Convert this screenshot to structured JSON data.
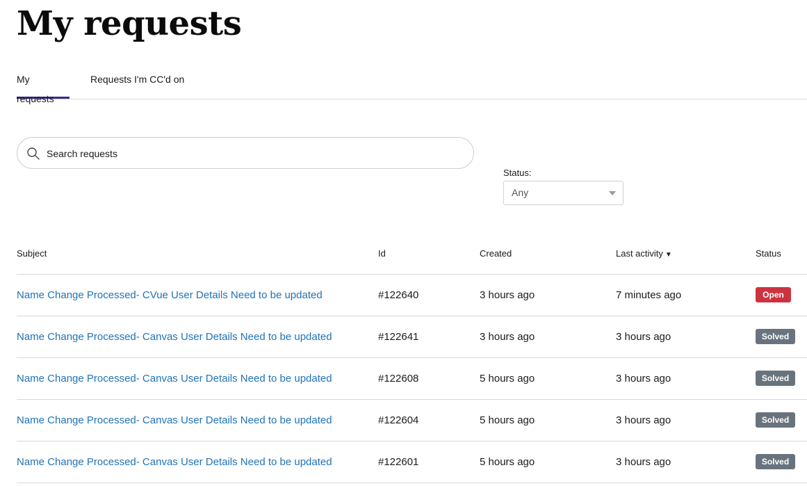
{
  "page": {
    "title": "My requests"
  },
  "tabs": [
    {
      "label": "My requests",
      "active": true
    },
    {
      "label": "Requests I'm CC'd on",
      "active": false
    }
  ],
  "search": {
    "placeholder": "Search requests",
    "value": "",
    "icon": "search-icon"
  },
  "filter": {
    "label": "Status:",
    "selected": "Any"
  },
  "table": {
    "headers": {
      "subject": "Subject",
      "id": "Id",
      "created": "Created",
      "last_activity": "Last activity",
      "status": "Status"
    },
    "sort_indicator": "▼",
    "rows": [
      {
        "subject": "Name Change Processed- CVue User Details Need to be updated",
        "id": "#122640",
        "created": "3 hours ago",
        "last_activity": "7 minutes ago",
        "status": "Open"
      },
      {
        "subject": "Name Change Processed- Canvas User Details Need to be updated",
        "id": "#122641",
        "created": "3 hours ago",
        "last_activity": "3 hours ago",
        "status": "Solved"
      },
      {
        "subject": "Name Change Processed- Canvas User Details Need to be updated",
        "id": "#122608",
        "created": "5 hours ago",
        "last_activity": "3 hours ago",
        "status": "Solved"
      },
      {
        "subject": "Name Change Processed- Canvas User Details Need to be updated",
        "id": "#122604",
        "created": "5 hours ago",
        "last_activity": "3 hours ago",
        "status": "Solved"
      },
      {
        "subject": "Name Change Processed- Canvas User Details Need to be updated",
        "id": "#122601",
        "created": "5 hours ago",
        "last_activity": "3 hours ago",
        "status": "Solved"
      }
    ]
  },
  "colors": {
    "accent": "#3b2a8e",
    "link": "#1f73b7",
    "open": "#cc3340",
    "solved": "#68737d"
  }
}
